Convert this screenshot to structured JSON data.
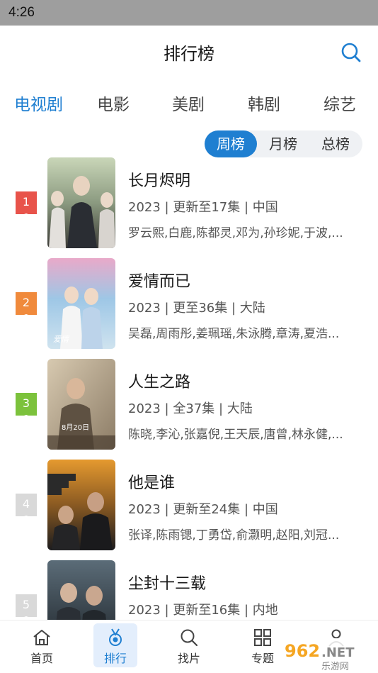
{
  "status_bar": {
    "time": "4:26"
  },
  "header": {
    "title": "排行榜",
    "search_icon": "search-icon"
  },
  "category_tabs": [
    {
      "label": "电视剧",
      "active": true
    },
    {
      "label": "电影",
      "active": false
    },
    {
      "label": "美剧",
      "active": false
    },
    {
      "label": "韩剧",
      "active": false
    },
    {
      "label": "综艺",
      "active": false
    }
  ],
  "period_tabs": [
    {
      "label": "周榜",
      "active": true
    },
    {
      "label": "月榜",
      "active": false
    },
    {
      "label": "总榜",
      "active": false
    }
  ],
  "colors": {
    "accent": "#1f7fd1",
    "rank1": "#e8534a",
    "rank2": "#f08a3c",
    "rank3": "#7cc23c",
    "rank_other": "#d9d9d9"
  },
  "items": [
    {
      "rank": "1",
      "title": "长月烬明",
      "meta": "2023 | 更新至17集 | 中国",
      "cast": "罗云熙,白鹿,陈都灵,邓为,孙珍妮,于波,..."
    },
    {
      "rank": "2",
      "title": "爱情而已",
      "meta": "2023 | 更至36集 | 大陆",
      "cast": "吴磊,周雨彤,姜珮瑶,朱泳腾,章涛,夏浩..."
    },
    {
      "rank": "3",
      "title": "人生之路",
      "meta": "2023 | 全37集 | 大陆",
      "cast": "陈晓,李沁,张嘉倪,王天辰,唐曾,林永健,..."
    },
    {
      "rank": "4",
      "title": "他是谁",
      "meta": "2023 | 更新至24集 | 中国",
      "cast": "张译,陈雨锶,丁勇岱,俞灏明,赵阳,刘冠..."
    },
    {
      "rank": "5",
      "title": "尘封十三载",
      "meta": "2023 | 更新至16集 | 内地",
      "cast": ""
    }
  ],
  "bottom_nav": [
    {
      "label": "首页",
      "icon": "home-icon",
      "active": false
    },
    {
      "label": "排行",
      "icon": "medal-icon",
      "active": true
    },
    {
      "label": "找片",
      "icon": "search-icon",
      "active": false
    },
    {
      "label": "专题",
      "icon": "grid-icon",
      "active": false
    },
    {
      "label": "",
      "icon": "profile-icon",
      "active": false
    }
  ],
  "watermark": {
    "text": "962.NET",
    "subtext": "乐游网"
  }
}
